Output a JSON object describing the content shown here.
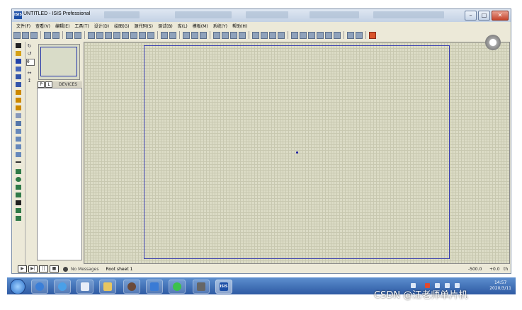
{
  "window": {
    "title": "UNTITLED - ISIS Professional",
    "icon_label": "ISIS",
    "controls": {
      "minimize": "–",
      "maximize": "□",
      "close": "✕"
    }
  },
  "menu": [
    "文件(F)",
    "查看(V)",
    "编辑(E)",
    "工具(T)",
    "设计(D)",
    "绘图(G)",
    "源代码(S)",
    "调试(B)",
    "库(L)",
    "模板(M)",
    "系统(Y)",
    "帮助(H)"
  ],
  "left_panel": {
    "zoom_value": "0",
    "tabs": [
      "P",
      "L"
    ],
    "devices_label": "DEVICES"
  },
  "status": {
    "controls": [
      "▶",
      "▶|",
      "||",
      "■"
    ],
    "message": "No Messages",
    "sheet": "Root sheet 1",
    "x_coord": "-500.0",
    "y_coord": "+0.0",
    "unit": "th"
  },
  "taskbar": {
    "time": "14:57",
    "date": "2020/3/11",
    "isis_label": "ISIS"
  },
  "watermark": "CSDN @汪老师单片机",
  "colors": {
    "canvas_bg": "#dcdcc6",
    "grid": "#c8c8b0",
    "sheet_border": "#3a3fb0",
    "taskbar": "#2e5aa3"
  }
}
